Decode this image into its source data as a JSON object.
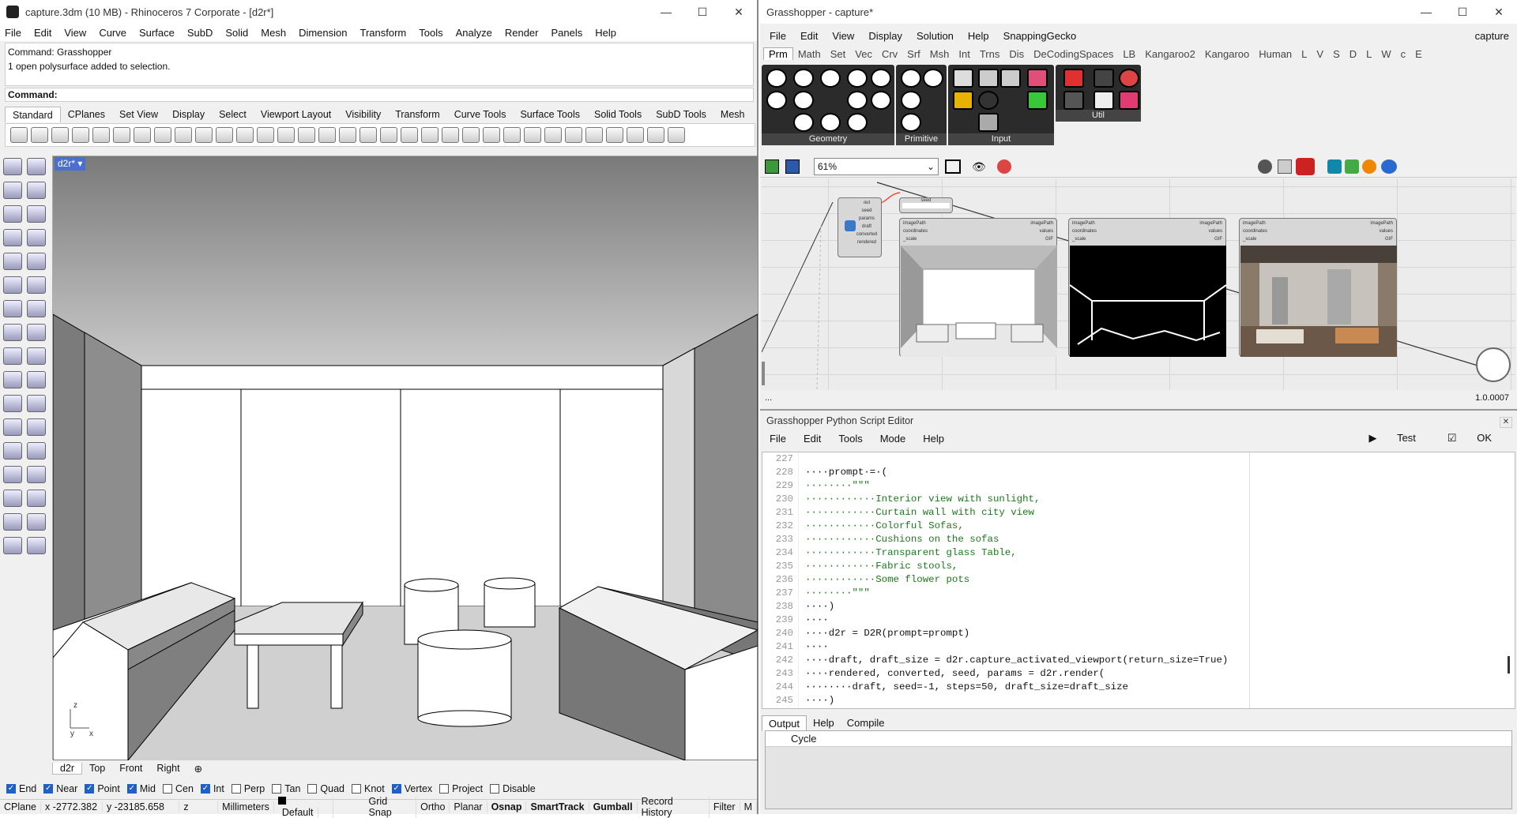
{
  "rhino": {
    "title": "capture.3dm (10 MB) - Rhinoceros 7 Corporate - [d2r*]",
    "menu": [
      "File",
      "Edit",
      "View",
      "Curve",
      "Surface",
      "SubD",
      "Solid",
      "Mesh",
      "Dimension",
      "Transform",
      "Tools",
      "Analyze",
      "Render",
      "Panels",
      "Help"
    ],
    "cmd_history": [
      "Command: Grasshopper",
      "1 open polysurface added to selection."
    ],
    "cmd_prompt": "Command:",
    "toolbar_tabs": [
      "Standard",
      "CPlanes",
      "Set View",
      "Display",
      "Select",
      "Viewport Layout",
      "Visibility",
      "Transform",
      "Curve Tools",
      "Surface Tools",
      "Solid Tools",
      "SubD Tools",
      "Mesh"
    ],
    "viewport_label": "d2r*",
    "axis": {
      "z": "z",
      "y": "y",
      "x": "x"
    },
    "view_tabs": [
      "d2r",
      "Top",
      "Front",
      "Right"
    ],
    "osnaps": [
      {
        "label": "End",
        "on": true
      },
      {
        "label": "Near",
        "on": true
      },
      {
        "label": "Point",
        "on": true
      },
      {
        "label": "Mid",
        "on": true
      },
      {
        "label": "Cen",
        "on": false
      },
      {
        "label": "Int",
        "on": true
      },
      {
        "label": "Perp",
        "on": false
      },
      {
        "label": "Tan",
        "on": false
      },
      {
        "label": "Quad",
        "on": false
      },
      {
        "label": "Knot",
        "on": false
      },
      {
        "label": "Vertex",
        "on": true
      },
      {
        "label": "Project",
        "on": false
      },
      {
        "label": "Disable",
        "on": false
      }
    ],
    "status": {
      "cplane": "CPlane",
      "x": "x -2772.382",
      "y": "y -23185.658",
      "z": "z",
      "units": "Millimeters",
      "layer": "Default",
      "toggles": [
        "Grid Snap",
        "Ortho",
        "Planar",
        "Osnap",
        "SmartTrack",
        "Gumball",
        "Record History",
        "Filter",
        "M"
      ]
    }
  },
  "gh": {
    "title": "Grasshopper - capture*",
    "menu": [
      "File",
      "Edit",
      "View",
      "Display",
      "Solution",
      "Help",
      "SnappingGecko"
    ],
    "doc_name": "capture",
    "tabs": [
      "Prm",
      "Math",
      "Set",
      "Vec",
      "Crv",
      "Srf",
      "Msh",
      "Int",
      "Trns",
      "Dis",
      "DeCodingSpaces",
      "LB",
      "Kangaroo2",
      "Kangaroo",
      "Human",
      "L",
      "V",
      "S",
      "D",
      "L",
      "W",
      "c",
      "E"
    ],
    "panels": [
      "Geometry",
      "Primitive",
      "Input",
      "Util"
    ],
    "zoom": "61%",
    "version": "1.0.0007",
    "ellipsis": "...",
    "python_outputs": [
      "out",
      "seed",
      "params",
      "draft",
      "converted",
      "rendered"
    ],
    "seed_label": "seed",
    "image_inputs": [
      "imagePath",
      "coordinates",
      "_scale"
    ],
    "image_outputs": [
      "imagePath",
      "values",
      "GIF"
    ]
  },
  "py": {
    "title": "Grasshopper Python Script Editor",
    "menu": [
      "File",
      "Edit",
      "Tools",
      "Mode",
      "Help"
    ],
    "test_label": "Test",
    "ok_label": "OK",
    "line_numbers": [
      "227",
      "228",
      "229",
      "230",
      "231",
      "232",
      "233",
      "234",
      "235",
      "236",
      "237",
      "238",
      "239",
      "240",
      "241",
      "242",
      "243",
      "244",
      "245"
    ],
    "code": [
      "",
      "····prompt·=·(",
      "········\"\"\"",
      "············Interior view with sunlight,",
      "············Curtain wall with city view",
      "············Colorful Sofas,",
      "············Cushions on the sofas",
      "············Transparent glass Table,",
      "············Fabric stools,",
      "············Some flower pots",
      "········\"\"\"",
      "····)",
      "····",
      "····d2r = D2R(prompt=prompt)",
      "····",
      "····draft, draft_size = d2r.capture_activated_viewport(return_size=True)",
      "····rendered, converted, seed, params = d2r.render(",
      "········draft, seed=-1, steps=50, draft_size=draft_size",
      "····)"
    ],
    "output_tabs": [
      "Output",
      "Help",
      "Compile"
    ],
    "output_header": "Cycle"
  }
}
